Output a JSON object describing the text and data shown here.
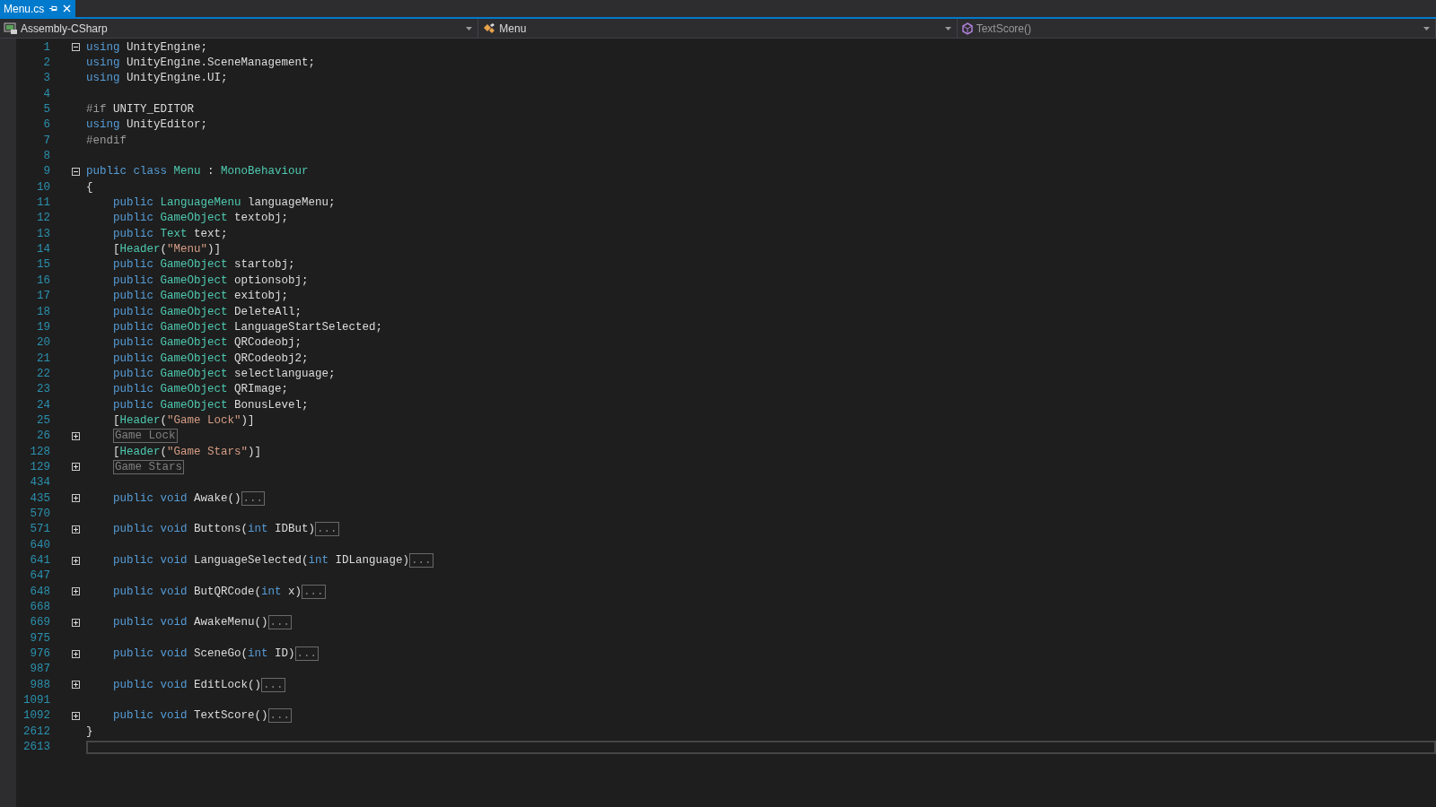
{
  "tabs": [
    {
      "label": "Menu.cs",
      "selected": true
    }
  ],
  "navigation": {
    "project": "Assembly-CSharp",
    "class": "Menu",
    "member": "TextScore()"
  },
  "editor": {
    "lines": [
      {
        "number": "1",
        "expanded": true,
        "tokens": [
          {
            "kind": "keyword",
            "text": "using"
          },
          {
            "kind": "plain",
            "text": " UnityEngine;"
          }
        ]
      },
      {
        "number": "2",
        "tokens": [
          {
            "kind": "keyword",
            "text": "using"
          },
          {
            "kind": "plain",
            "text": " UnityEngine.SceneManagement;"
          }
        ]
      },
      {
        "number": "3",
        "tokens": [
          {
            "kind": "keyword",
            "text": "using"
          },
          {
            "kind": "plain",
            "text": " UnityEngine.UI;"
          }
        ]
      },
      {
        "number": "4"
      },
      {
        "number": "5",
        "tokens": [
          {
            "kind": "preprocessor",
            "text": "#if"
          },
          {
            "kind": "plain",
            "text": " UNITY_EDITOR"
          }
        ]
      },
      {
        "number": "6",
        "tokens": [
          {
            "kind": "keyword",
            "text": "using"
          },
          {
            "kind": "plain",
            "text": " UnityEditor;"
          }
        ]
      },
      {
        "number": "7",
        "tokens": [
          {
            "kind": "preprocessor",
            "text": "#endif"
          }
        ]
      },
      {
        "number": "8"
      },
      {
        "number": "9",
        "expanded": true,
        "tokens": [
          {
            "kind": "keyword",
            "text": "public class "
          },
          {
            "kind": "type",
            "text": "Menu"
          },
          {
            "kind": "plain",
            "text": " : "
          },
          {
            "kind": "type",
            "text": "MonoBehaviour"
          }
        ]
      },
      {
        "number": "10",
        "tokens": [
          {
            "kind": "plain",
            "text": "{"
          }
        ],
        "children": [
          {
            "number": "11",
            "tokens": [
              {
                "kind": "keyword",
                "text": "public "
              },
              {
                "kind": "type",
                "text": "LanguageMenu"
              },
              {
                "kind": "plain",
                "text": " languageMenu;"
              }
            ]
          },
          {
            "number": "12",
            "tokens": [
              {
                "kind": "keyword",
                "text": "public "
              },
              {
                "kind": "type",
                "text": "GameObject"
              },
              {
                "kind": "plain",
                "text": " textobj;"
              }
            ]
          },
          {
            "number": "13",
            "tokens": [
              {
                "kind": "keyword",
                "text": "public "
              },
              {
                "kind": "type",
                "text": "Text"
              },
              {
                "kind": "plain",
                "text": " text;"
              }
            ]
          },
          {
            "number": "14",
            "tokens": [
              {
                "kind": "plain",
                "text": "["
              },
              {
                "kind": "type",
                "text": "Header"
              },
              {
                "kind": "plain",
                "text": "("
              },
              {
                "kind": "string",
                "text": "\"Menu\""
              },
              {
                "kind": "plain",
                "text": ")]"
              }
            ]
          },
          {
            "number": "15",
            "tokens": [
              {
                "kind": "keyword",
                "text": "public "
              },
              {
                "kind": "type",
                "text": "GameObject"
              },
              {
                "kind": "plain",
                "text": " startobj;"
              }
            ]
          },
          {
            "number": "16",
            "tokens": [
              {
                "kind": "keyword",
                "text": "public "
              },
              {
                "kind": "type",
                "text": "GameObject"
              },
              {
                "kind": "plain",
                "text": " optionsobj;"
              }
            ]
          },
          {
            "number": "17",
            "tokens": [
              {
                "kind": "keyword",
                "text": "public "
              },
              {
                "kind": "type",
                "text": "GameObject"
              },
              {
                "kind": "plain",
                "text": " exitobj;"
              }
            ]
          },
          {
            "number": "18",
            "tokens": [
              {
                "kind": "keyword",
                "text": "public "
              },
              {
                "kind": "type",
                "text": "GameObject"
              },
              {
                "kind": "plain",
                "text": " DeleteAll;"
              }
            ]
          },
          {
            "number": "19",
            "tokens": [
              {
                "kind": "keyword",
                "text": "public "
              },
              {
                "kind": "type",
                "text": "GameObject"
              },
              {
                "kind": "plain",
                "text": " LanguageStartSelected;"
              }
            ]
          },
          {
            "number": "20",
            "tokens": [
              {
                "kind": "keyword",
                "text": "public "
              },
              {
                "kind": "type",
                "text": "GameObject"
              },
              {
                "kind": "plain",
                "text": " QRCodeobj;"
              }
            ]
          },
          {
            "number": "21",
            "tokens": [
              {
                "kind": "keyword",
                "text": "public "
              },
              {
                "kind": "type",
                "text": "GameObject"
              },
              {
                "kind": "plain",
                "text": " QRCodeobj2;"
              }
            ]
          },
          {
            "number": "22",
            "tokens": [
              {
                "kind": "keyword",
                "text": "public "
              },
              {
                "kind": "type",
                "text": "GameObject"
              },
              {
                "kind": "plain",
                "text": " selectlanguage;"
              }
            ]
          },
          {
            "number": "23",
            "tokens": [
              {
                "kind": "keyword",
                "text": "public "
              },
              {
                "kind": "type",
                "text": "GameObject"
              },
              {
                "kind": "plain",
                "text": " QRImage;"
              }
            ]
          },
          {
            "number": "24",
            "tokens": [
              {
                "kind": "keyword",
                "text": "public "
              },
              {
                "kind": "type",
                "text": "GameObject"
              },
              {
                "kind": "plain",
                "text": " BonusLevel;"
              }
            ]
          },
          {
            "number": "25",
            "tokens": [
              {
                "kind": "plain",
                "text": "["
              },
              {
                "kind": "type",
                "text": "Header"
              },
              {
                "kind": "plain",
                "text": "("
              },
              {
                "kind": "string",
                "text": "\"Game Lock\""
              },
              {
                "kind": "plain",
                "text": ")]"
              }
            ]
          },
          {
            "number": "26",
            "expanded": false,
            "tokens": [
              {
                "kind": "collapsed",
                "text": "Game Lock"
              }
            ]
          },
          {
            "number": "128",
            "tokens": [
              {
                "kind": "plain",
                "text": "["
              },
              {
                "kind": "type",
                "text": "Header"
              },
              {
                "kind": "plain",
                "text": "("
              },
              {
                "kind": "string",
                "text": "\"Game Stars\""
              },
              {
                "kind": "plain",
                "text": ")]"
              }
            ]
          },
          {
            "number": "129",
            "expanded": false,
            "tokens": [
              {
                "kind": "collapsed",
                "text": "Game Stars"
              }
            ]
          },
          {
            "number": "434"
          },
          {
            "number": "435",
            "expanded": false,
            "tokens": [
              {
                "kind": "keyword",
                "text": "public void "
              },
              {
                "kind": "plain",
                "text": "Awake()"
              },
              {
                "kind": "collapsed",
                "text": "..."
              }
            ]
          },
          {
            "number": "570"
          },
          {
            "number": "571",
            "expanded": false,
            "tokens": [
              {
                "kind": "keyword",
                "text": "public void "
              },
              {
                "kind": "plain",
                "text": "Buttons("
              },
              {
                "kind": "keyword",
                "text": "int"
              },
              {
                "kind": "plain",
                "text": " IDBut)"
              },
              {
                "kind": "collapsed",
                "text": "..."
              }
            ]
          },
          {
            "number": "640"
          },
          {
            "number": "641",
            "expanded": false,
            "tokens": [
              {
                "kind": "keyword",
                "text": "public void "
              },
              {
                "kind": "plain",
                "text": "LanguageSelected("
              },
              {
                "kind": "keyword",
                "text": "int"
              },
              {
                "kind": "plain",
                "text": " IDLanguage)"
              },
              {
                "kind": "collapsed",
                "text": "..."
              }
            ]
          },
          {
            "number": "647"
          },
          {
            "number": "648",
            "expanded": false,
            "tokens": [
              {
                "kind": "keyword",
                "text": "public void "
              },
              {
                "kind": "plain",
                "text": "ButQRCode("
              },
              {
                "kind": "keyword",
                "text": "int"
              },
              {
                "kind": "plain",
                "text": " x)"
              },
              {
                "kind": "collapsed",
                "text": "..."
              }
            ]
          },
          {
            "number": "668"
          },
          {
            "number": "669",
            "expanded": false,
            "tokens": [
              {
                "kind": "keyword",
                "text": "public void "
              },
              {
                "kind": "plain",
                "text": "AwakeMenu()"
              },
              {
                "kind": "collapsed",
                "text": "..."
              }
            ]
          },
          {
            "number": "975"
          },
          {
            "number": "976",
            "expanded": false,
            "tokens": [
              {
                "kind": "keyword",
                "text": "public void "
              },
              {
                "kind": "plain",
                "text": "SceneGo("
              },
              {
                "kind": "keyword",
                "text": "int"
              },
              {
                "kind": "plain",
                "text": " ID)"
              },
              {
                "kind": "collapsed",
                "text": "..."
              }
            ]
          },
          {
            "number": "987"
          },
          {
            "number": "988",
            "expanded": false,
            "tokens": [
              {
                "kind": "keyword",
                "text": "public void "
              },
              {
                "kind": "plain",
                "text": "EditLock()"
              },
              {
                "kind": "collapsed",
                "text": "..."
              }
            ]
          },
          {
            "number": "1091"
          },
          {
            "number": "1092",
            "expanded": false,
            "tokens": [
              {
                "kind": "keyword",
                "text": "public void "
              },
              {
                "kind": "plain",
                "text": "TextScore()"
              },
              {
                "kind": "collapsed",
                "text": "..."
              }
            ]
          }
        ]
      },
      {
        "number": "2612",
        "tokens": [
          {
            "kind": "plain",
            "text": "}"
          }
        ]
      },
      {
        "number": "2613",
        "current": true
      }
    ]
  }
}
